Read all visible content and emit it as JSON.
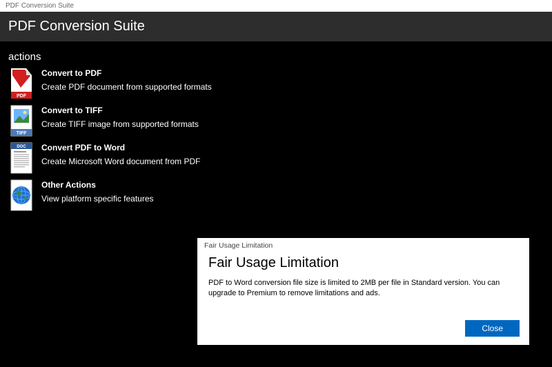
{
  "window": {
    "title": "PDF Conversion Suite"
  },
  "header": {
    "title": "PDF Conversion Suite"
  },
  "actions": {
    "label": "actions",
    "items": [
      {
        "title": "Convert to PDF",
        "desc": "Create PDF document from supported formats"
      },
      {
        "title": "Convert to TIFF",
        "desc": "Create TIFF image from supported formats"
      },
      {
        "title": "Convert PDF to Word",
        "desc": "Create Microsoft Word document from PDF"
      },
      {
        "title": "Other Actions",
        "desc": "View platform specific features"
      }
    ]
  },
  "dialog": {
    "titlebar": "Fair Usage Limitation",
    "heading": "Fair Usage Limitation",
    "text": "PDF to Word conversion file size is limited to 2MB per file in Standard version. You can upgrade to Premium to remove limitations and ads.",
    "close_label": "Close"
  },
  "colors": {
    "accent": "#0067c0"
  }
}
